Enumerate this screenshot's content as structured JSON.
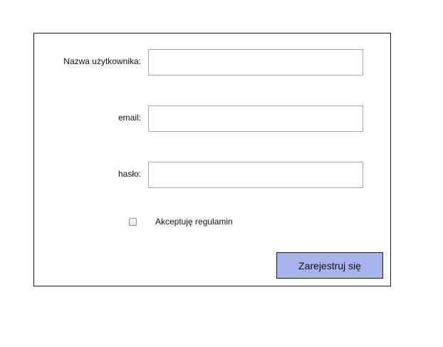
{
  "form": {
    "username_label": "Nazwa użytkownika:",
    "username_value": "",
    "email_label": "email:",
    "email_value": "",
    "password_label": "hasło:",
    "password_value": "",
    "terms_label": "Akceptuję regulamin",
    "terms_checked": false,
    "submit_label": "Zarejestruj się"
  },
  "colors": {
    "panel_border": "#1a1a1a",
    "input_border": "#a8a8a8",
    "button_background": "#a7b3ec"
  }
}
